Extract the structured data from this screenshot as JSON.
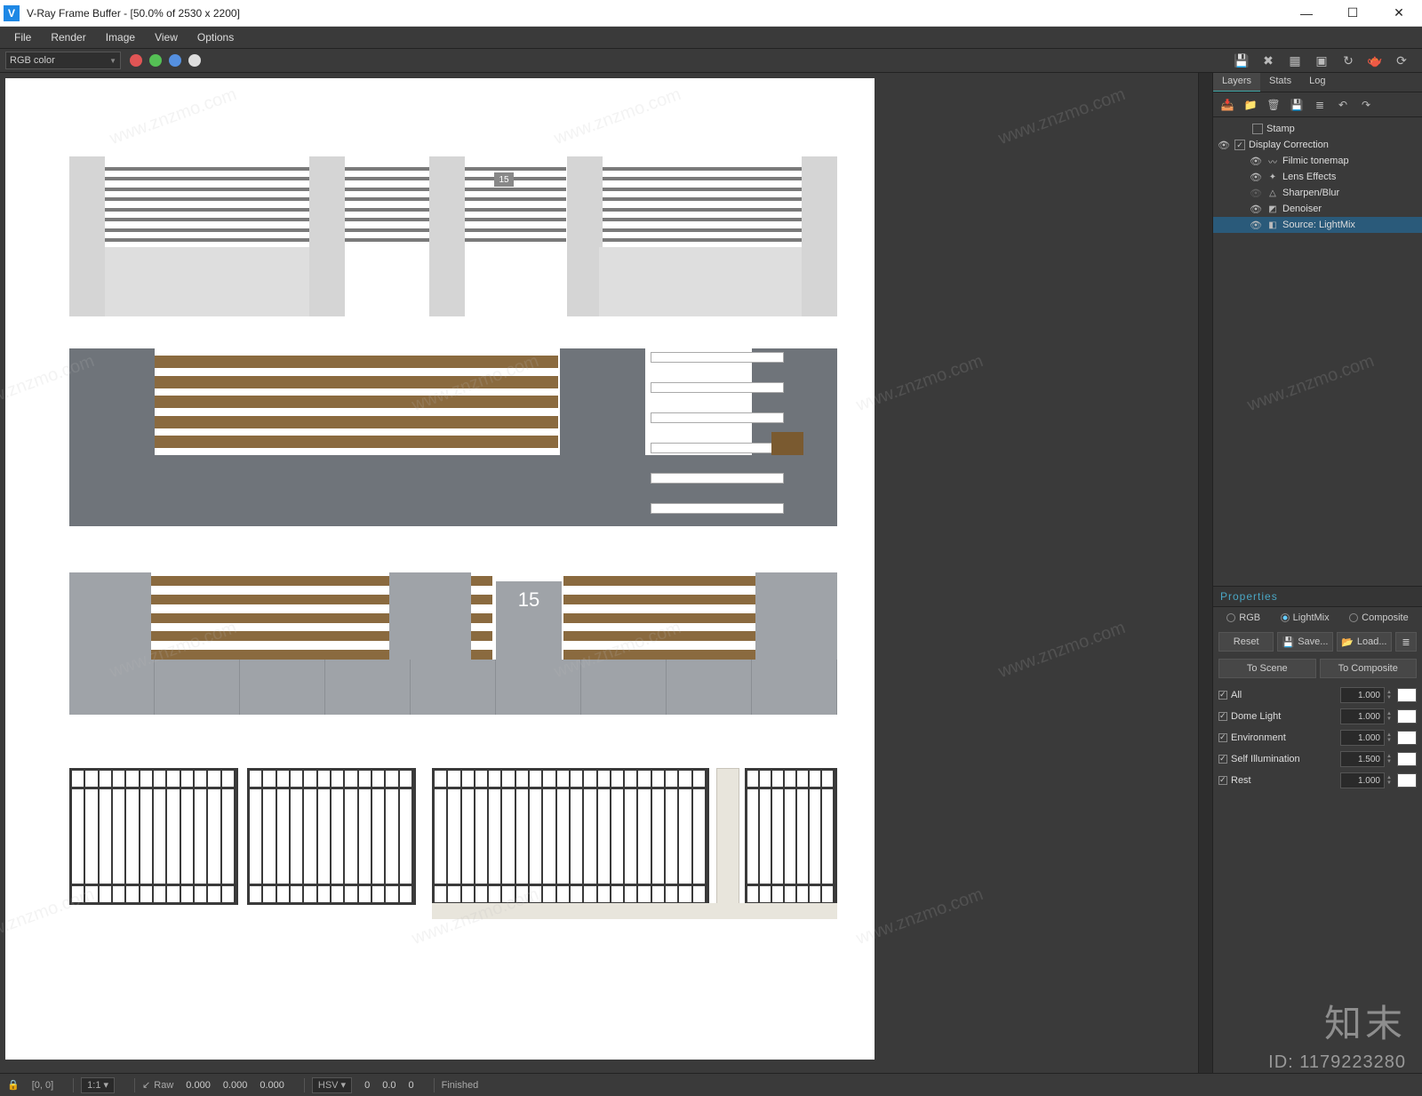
{
  "window": {
    "title": "V-Ray Frame Buffer - [50.0% of 2530 x 2200]",
    "logo_letter": "V"
  },
  "menu": {
    "items": [
      "File",
      "Render",
      "Image",
      "View",
      "Options"
    ]
  },
  "toolbar": {
    "channel": "RGB color"
  },
  "side": {
    "tabs": [
      "Layers",
      "Stats",
      "Log"
    ],
    "active_tab": "Layers",
    "layers": {
      "stamp": "Stamp",
      "display_correction": "Display Correction",
      "filmic": "Filmic tonemap",
      "lens": "Lens Effects",
      "sharpen": "Sharpen/Blur",
      "denoiser": "Denoiser",
      "source": "Source: LightMix"
    },
    "properties": {
      "heading": "Properties",
      "modes": {
        "rgb": "RGB",
        "lightmix": "LightMix",
        "composite": "Composite"
      },
      "buttons": {
        "reset": "Reset",
        "save": "Save...",
        "load": "Load...",
        "to_scene": "To Scene",
        "to_composite": "To Composite"
      },
      "rows": [
        {
          "name": "All",
          "value": "1.000"
        },
        {
          "name": "Dome Light",
          "value": "1.000"
        },
        {
          "name": "Environment",
          "value": "1.000"
        },
        {
          "name": "Self Illumination",
          "value": "1.500"
        },
        {
          "name": "Rest",
          "value": "1.000"
        }
      ]
    }
  },
  "status": {
    "lock": "🔒",
    "coord": "[0, 0]",
    "zoom": "1:1 ▾",
    "raw": "Raw",
    "raw_vals": [
      "0.000",
      "0.000",
      "0.000"
    ],
    "hsv": "HSV ▾",
    "hsv_vals": [
      "0",
      "0.0",
      "0"
    ],
    "finished": "Finished"
  },
  "render": {
    "house_number_small": "15",
    "house_number_big": "15"
  },
  "watermark": {
    "brand": "知末",
    "id": "ID: 1179223280",
    "url": "www.znzmo.com"
  }
}
